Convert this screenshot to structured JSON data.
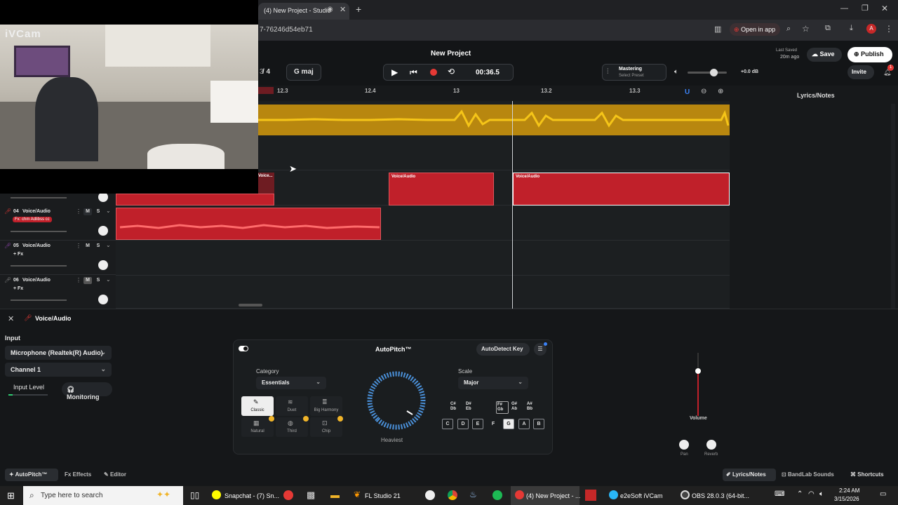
{
  "browser": {
    "tab_title": "(4) New Project - Studio",
    "url_fragment": "7-76246d54eb71",
    "open_in_app": "Open in app"
  },
  "header": {
    "project_title": "New Project",
    "last_saved_label": "Last Saved",
    "last_saved_time": "20m ago",
    "save_label": "Save",
    "publish_label": "Publish",
    "invite_label": "Invite",
    "notification_count": "1",
    "time_sig": "/ 4",
    "time_sig_left": "3",
    "key": "G maj",
    "time": "00:36.5",
    "mastering_label": "Mastering",
    "mastering_preset": "Select Preset",
    "volume_db": "+0.0 dB"
  },
  "ruler": {
    "ticks": [
      "12.3",
      "12.4",
      "13",
      "13.2",
      "13.3"
    ]
  },
  "clips": {
    "clip1_label": "Voice...",
    "clip2_label": "Voice/Audio",
    "clip3_label": "Voice/Audio"
  },
  "tracks": [
    {
      "num": "04",
      "name": "Voice/Audio",
      "fx": "Fx: chm Adlibss cc"
    },
    {
      "num": "05",
      "name": "Voice/Audio",
      "fx": "+ Fx"
    },
    {
      "num": "06",
      "name": "Voice/Audio",
      "fx": "+ Fx"
    }
  ],
  "track_buttons": {
    "mute": "M",
    "solo": "S"
  },
  "side_panel": {
    "title": "Lyrics/Notes"
  },
  "editor": {
    "track_name": "Voice/Audio",
    "input_label": "Input",
    "input_device": "Microphone (Realtek(R) Audio)",
    "channel": "Channel 1",
    "input_level_label": "Input Level",
    "monitoring_label": "Monitoring",
    "volume_label": "Volume",
    "pan_label": "Pan",
    "reverb_label": "Reverb"
  },
  "autopitch": {
    "title": "AutoPitch™",
    "autodetect_label": "AutoDetect Key",
    "category_label": "Category",
    "category_value": "Essentials",
    "scale_label": "Scale",
    "scale_value": "Major",
    "knob_label": "Heaviest",
    "presets": [
      "Classic",
      "Duet",
      "Big Harmony",
      "Natural",
      "Third",
      "Chip"
    ],
    "sharp_keys": [
      "C#",
      "D#",
      "F#",
      "G#",
      "A#"
    ],
    "flat_keys": [
      "Db",
      "Eb",
      "Gb",
      "Ab",
      "Bb"
    ],
    "natural_keys": [
      "C",
      "D",
      "E",
      "F",
      "G",
      "A",
      "B"
    ]
  },
  "footer": {
    "autopitch_tab": "AutoPitch™",
    "effects_tab": "Effects",
    "editor_tab": "Editor",
    "lyrics_tab": "Lyrics/Notes",
    "sounds_tab": "BandLab Sounds",
    "shortcuts_tab": "Shortcuts"
  },
  "webcam": {
    "label": "iVCam"
  },
  "taskbar": {
    "search_placeholder": "Type here to search",
    "snapchat": "Snapchat - (7) Sn...",
    "fl_studio": "FL Studio 21",
    "chrome": "(4) New Project - ...",
    "ivcam": "e2eSoft iVCam",
    "obs": "OBS 28.0.3 (64-bit...",
    "time": "2:24 AM",
    "date": "3/15/2026"
  },
  "colors": {
    "accent_red": "#c0202a",
    "waveform_yellow": "#d4a017",
    "record": "#e53935"
  }
}
